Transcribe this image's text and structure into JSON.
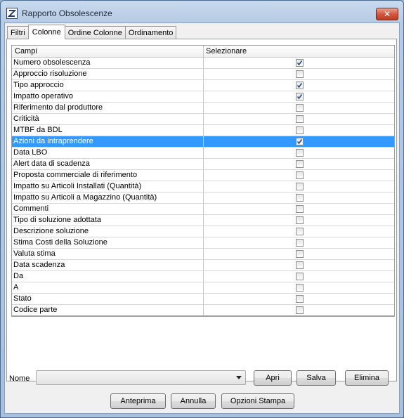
{
  "window": {
    "title": "Rapporto Obsolescenze",
    "close_glyph": "✕"
  },
  "tabs": [
    {
      "label": "Filtri",
      "active": false
    },
    {
      "label": "Colonne",
      "active": true
    },
    {
      "label": "Ordine Colonne",
      "active": false
    },
    {
      "label": "Ordinamento",
      "active": false
    }
  ],
  "grid": {
    "headers": {
      "field": "Campi",
      "select": "Selezionare"
    },
    "rows": [
      {
        "label": "Numero obsolescenza",
        "checked": true
      },
      {
        "label": "Approccio risoluzione",
        "checked": false
      },
      {
        "label": "Tipo approccio",
        "checked": true
      },
      {
        "label": "Impatto operativo",
        "checked": true
      },
      {
        "label": "Riferimento dal produttore",
        "checked": false
      },
      {
        "label": "Criticità",
        "checked": false
      },
      {
        "label": "MTBF da BDL",
        "checked": false
      },
      {
        "label": "Azioni da intraprendere",
        "checked": true,
        "selected": true
      },
      {
        "label": "Data LBO",
        "checked": false
      },
      {
        "label": "Alert data di scadenza",
        "checked": false
      },
      {
        "label": "Proposta commerciale di riferimento",
        "checked": false
      },
      {
        "label": "Impatto su Articoli Installati (Quantità)",
        "checked": false
      },
      {
        "label": "Impatto su Articoli a Magazzino (Quantità)",
        "checked": false
      },
      {
        "label": "Commenti",
        "checked": false
      },
      {
        "label": "Tipo di soluzione adottata",
        "checked": false
      },
      {
        "label": "Descrizione soluzione",
        "checked": false
      },
      {
        "label": "Stima Costi della Soluzione",
        "checked": false
      },
      {
        "label": "Valuta stima",
        "checked": false
      },
      {
        "label": "Data scadenza",
        "checked": false
      },
      {
        "label": "Da",
        "checked": false
      },
      {
        "label": "A",
        "checked": false
      },
      {
        "label": "Stato",
        "checked": false
      },
      {
        "label": "Codice parte",
        "checked": false
      }
    ]
  },
  "footer": {
    "nome_label": "Nome",
    "nome_value": "",
    "apri": "Apri",
    "salva": "Salva",
    "elimina": "Elimina",
    "anteprima": "Anteprima",
    "annulla": "Annulla",
    "opzioni_stampa": "Opzioni Stampa"
  },
  "colors": {
    "selection": "#3399ff",
    "check": "#2a4c8a"
  }
}
